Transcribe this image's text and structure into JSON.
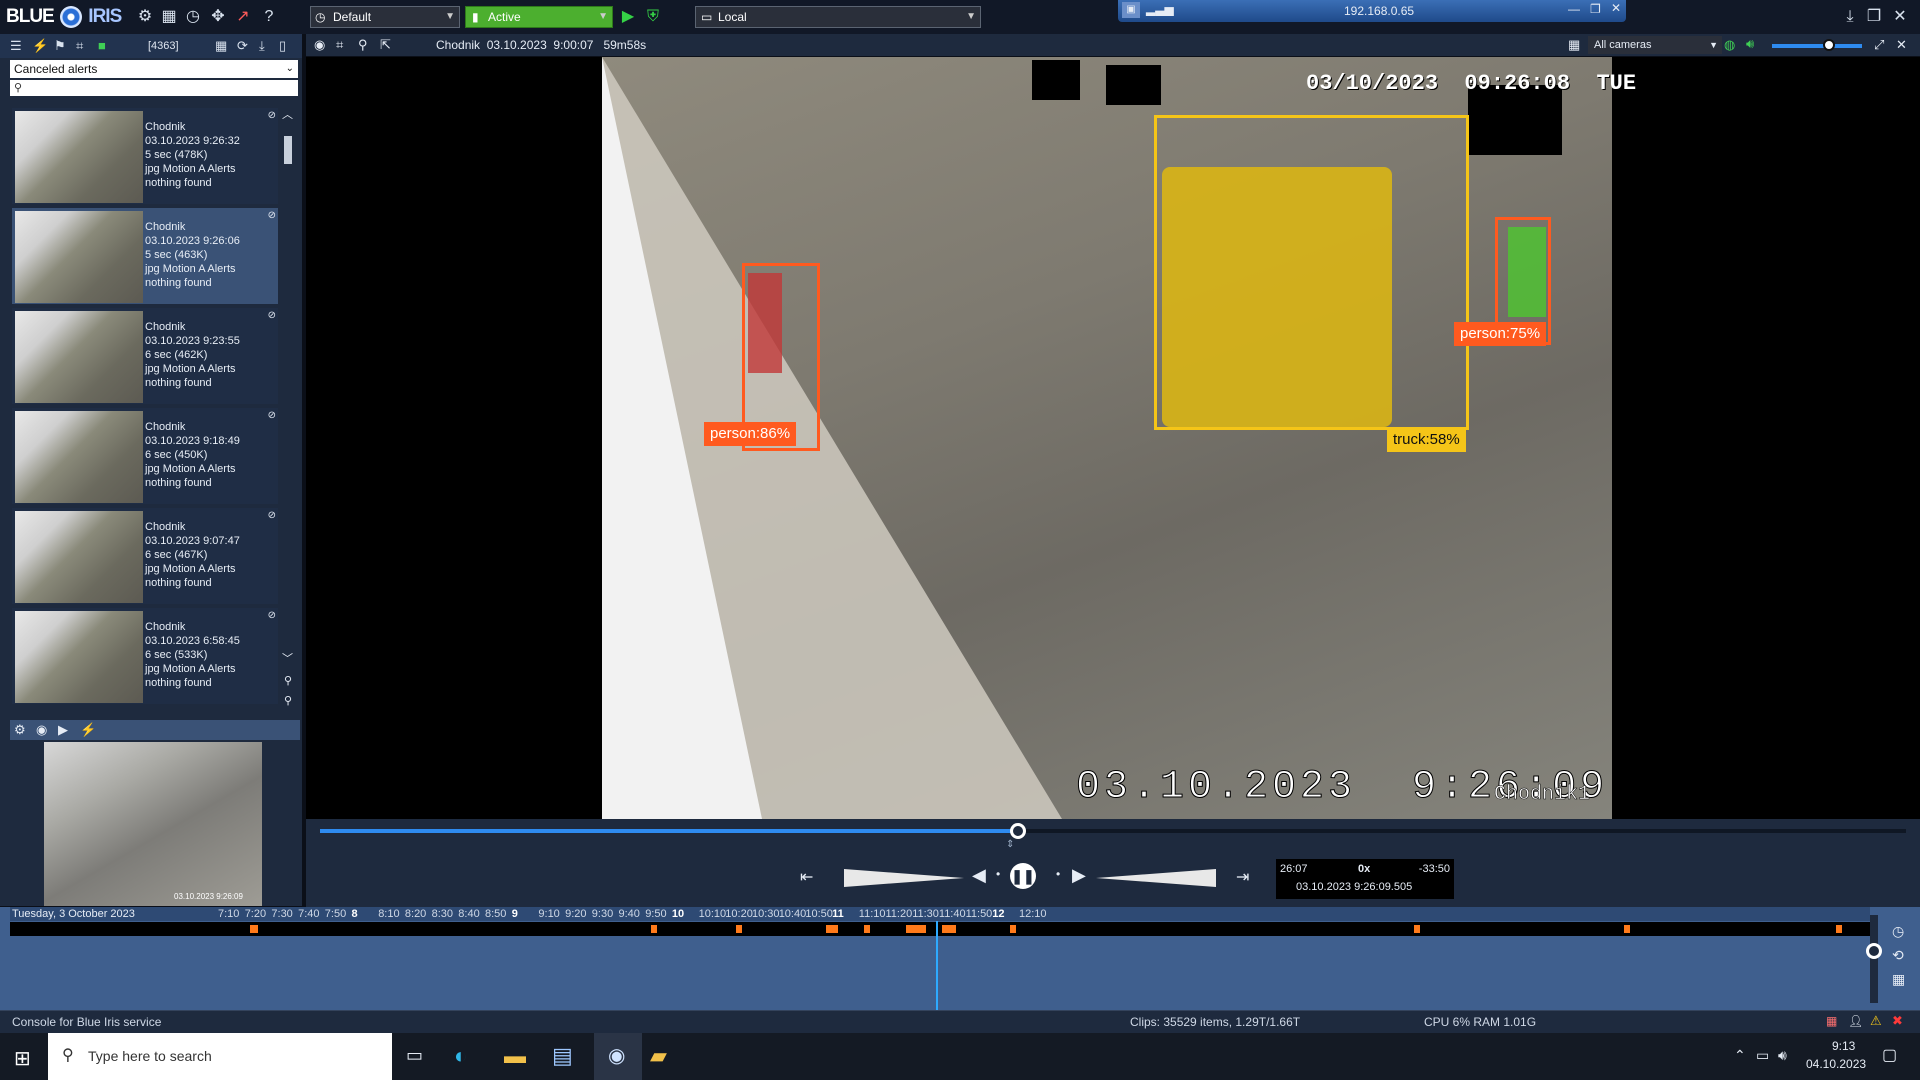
{
  "app": {
    "logo_left": "BLUE",
    "logo_right": "IRIS"
  },
  "toolbar": {
    "profile": "Default",
    "schedule": "Active",
    "server": "Local",
    "ip": "192.168.0.65"
  },
  "left": {
    "count": "[4363]",
    "filter": "Canceled alerts",
    "search_placeholder": "",
    "alerts": [
      {
        "camera": "Chodnik",
        "time": "03.10.2023  9:26:32",
        "size": "5 sec (478K)",
        "type": "jpg Motion A Alerts",
        "ai": "nothing found"
      },
      {
        "camera": "Chodnik",
        "time": "03.10.2023  9:26:06",
        "size": "5 sec (463K)",
        "type": "jpg Motion A Alerts",
        "ai": "nothing found"
      },
      {
        "camera": "Chodnik",
        "time": "03.10.2023  9:23:55",
        "size": "6 sec (462K)",
        "type": "jpg Motion A Alerts",
        "ai": "nothing found"
      },
      {
        "camera": "Chodnik",
        "time": "03.10.2023  9:18:49",
        "size": "6 sec (450K)",
        "type": "jpg Motion A Alerts",
        "ai": "nothing found"
      },
      {
        "camera": "Chodnik",
        "time": "03.10.2023  9:07:47",
        "size": "6 sec (467K)",
        "type": "jpg Motion A Alerts",
        "ai": "nothing found"
      },
      {
        "camera": "Chodnik",
        "time": "03.10.2023  6:58:45",
        "size": "6 sec (533K)",
        "type": "jpg Motion A Alerts",
        "ai": "nothing found"
      }
    ],
    "preview_stamp": "03.10.2023 9:26:09"
  },
  "clip": {
    "title": "Chodnik  03.10.2023  9:00:07   59m58s"
  },
  "camera_select": "All cameras",
  "video": {
    "osd_top": "03/10/2023  09:26:08  TUE",
    "osd_bottom": "03.10.2023  9:26:09",
    "camera_name": "Chodnik1",
    "detections": [
      {
        "label": "person:86%",
        "color": "#ff5a1f"
      },
      {
        "label": "truck:58%",
        "color": "#f5c518"
      },
      {
        "label": "person:75%",
        "color": "#ff5a1f"
      }
    ]
  },
  "playback": {
    "elapsed": "26:07",
    "speed": "0x",
    "remaining": "-33:50",
    "timestamp": "03.10.2023 9:26:09.505",
    "progress": 0.44
  },
  "timeline": {
    "date": "Tuesday, 3 October 2023",
    "ticks": [
      "7:10",
      "7:20",
      "7:30",
      "7:40",
      "7:50",
      "8",
      "8:10",
      "8:20",
      "8:30",
      "8:40",
      "8:50",
      "9",
      "9:10",
      "9:20",
      "9:30",
      "9:40",
      "9:50",
      "10",
      "10:10",
      "10:20",
      "10:30",
      "10:40",
      "10:50",
      "11",
      "11:10",
      "11:20",
      "11:30",
      "11:40",
      "11:50",
      "12",
      "12:10"
    ]
  },
  "status": {
    "left": "Console for Blue Iris service",
    "clips": "Clips: 35529 items, 1.29T/1.66T",
    "cpu": "CPU 6% RAM 1.01G"
  },
  "taskbar": {
    "search_placeholder": "Type here to search",
    "time": "9:13",
    "date": "04.10.2023"
  }
}
